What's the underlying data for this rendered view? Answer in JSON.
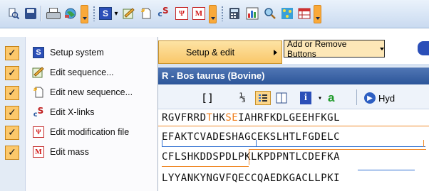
{
  "toolbar": {
    "icons": [
      "zoom-icon",
      "save-icon",
      "print-icon",
      "globe-icon",
      "setup-system-icon",
      "edit-sequence-icon",
      "new-sequence-icon",
      "crosslinks-icon",
      "modification-icon",
      "mass-icon",
      "calculator-icon",
      "chart-icon",
      "search-icon",
      "network-icon",
      "table-icon"
    ],
    "dropdown_arrow": "▾"
  },
  "menu": {
    "items": [
      {
        "label": "Setup system",
        "icon": "S",
        "checked": true
      },
      {
        "label": "Edit sequence...",
        "icon": "seq",
        "checked": true
      },
      {
        "label": "Edit new sequence...",
        "icon": "new",
        "checked": true
      },
      {
        "label": "Edit X-links",
        "icon": "cs",
        "checked": true
      },
      {
        "label": "Edit modification file",
        "icon": "mod",
        "checked": true
      },
      {
        "label": "Edit mass",
        "icon": "M",
        "checked": true
      }
    ],
    "check_glyph": "✓"
  },
  "submenu": {
    "label": "Setup & edit",
    "add_remove_label": "Add or Remove Buttons"
  },
  "window": {
    "title": "R - Bos taurus (Bovine)",
    "toolbar_items": [
      "[]",
      "⅓",
      "a",
      "Hyd"
    ]
  },
  "sequence": {
    "lines": [
      {
        "pre": "RGVFRRD",
        "o1": "T",
        "mid": "HK",
        "o2": "SE",
        "post": "IAHRFKDLGEEHFKGL"
      },
      {
        "pre": "EFAKTCVADESHAGCEKSLHTLFGDELC",
        "o1": "",
        "mid": "",
        "o2": "",
        "post": ""
      },
      {
        "pre": "CFLSHKDDSPDLPKLKPDPNTLCDEFKA",
        "o1": "",
        "mid": "",
        "o2": "",
        "post": ""
      },
      {
        "pre": "LYYANKYNGVFQECCQAEDKGACLLPKI",
        "o1": "",
        "mid": "",
        "o2": "",
        "post": ""
      }
    ]
  },
  "colors": {
    "menu_check_bg": "#fcc86b",
    "title_bar": "#2c5599",
    "highlight_orange": "#f08020",
    "link_blue": "#2e6fd1"
  }
}
